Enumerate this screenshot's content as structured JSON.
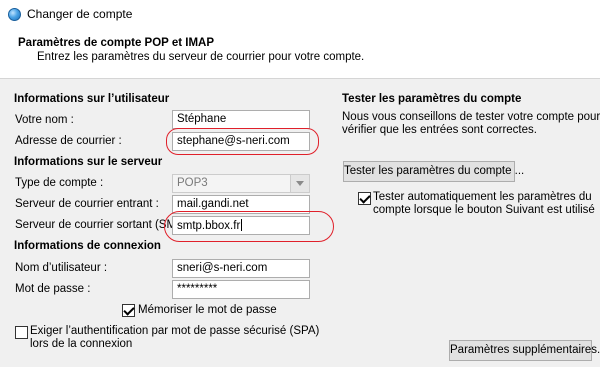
{
  "window": {
    "title": "Changer de compte"
  },
  "header": {
    "title": "Paramètres de compte POP et IMAP",
    "subtitle": "Entrez les paramètres du serveur de courrier pour votre compte."
  },
  "user_info": {
    "section_label": "Informations sur l’utilisateur",
    "name_label": "Votre nom :",
    "name_value": "Stéphane",
    "email_label": "Adresse de courrier :",
    "email_value": "stephane@s-neri.com"
  },
  "server_info": {
    "section_label": "Informations sur le serveur",
    "account_type_label": "Type de compte :",
    "account_type_value": "POP3",
    "incoming_label": "Serveur de courrier entrant :",
    "incoming_value": "mail.gandi.net",
    "outgoing_label": "Serveur de courrier sortant (SMTP) :",
    "outgoing_value": "smtp.bbox.fr"
  },
  "login_info": {
    "section_label": "Informations de connexion",
    "username_label": "Nom d’utilisateur :",
    "username_value": "sneri@s-neri.com",
    "password_label": "Mot de passe :",
    "password_value": "*********",
    "remember_label": "Mémoriser le mot de passe",
    "remember_checked": true,
    "spa_label_line1": "Exiger l’authentification par mot de passe sécurisé (SPA)",
    "spa_label_line2": "lors de la connexion",
    "spa_checked": false
  },
  "test_panel": {
    "section_label": "Tester les paramètres du compte",
    "description_line1": "Nous vous conseillons de tester votre compte pour",
    "description_line2": "vérifier que les entrées sont correctes.",
    "test_button": "Tester les paramètres du compte ...",
    "auto_test_line1": "Tester automatiquement les paramètres du",
    "auto_test_line2": "compte lorsque le bouton Suivant est utilisé",
    "auto_test_checked": true
  },
  "more_settings_button": "Paramètres supplémentaires...",
  "annotation_color": "#e0202a"
}
